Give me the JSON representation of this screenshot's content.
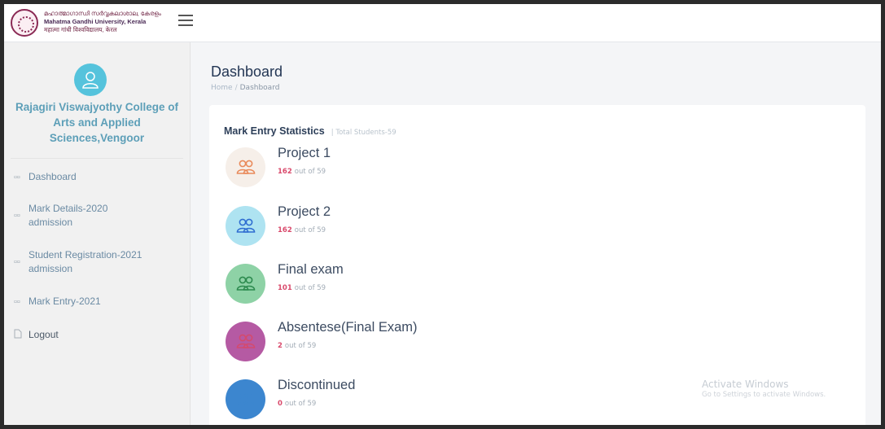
{
  "header": {
    "university_lines": [
      "മഹാത്മാഗാന്ധി സർവ്വകലാശാല, കേരളം",
      "Mahatma Gandhi University, Kerala",
      "महात्मा गांधी विश्वविद्यालय, केरल"
    ],
    "logo_icon": "university-seal-icon",
    "menu_icon": "hamburger-menu-icon"
  },
  "sidebar": {
    "avatar_icon": "user-avatar-icon",
    "avatar_color": "#55c3dc",
    "college_name": "Rajagiri Viswajyothy College of Arts and Applied Sciences,Vengoor",
    "items": [
      {
        "label": "Dashboard",
        "icon": "grid-icon"
      },
      {
        "label": "Mark Details-2020 admission",
        "icon": "grid-icon"
      },
      {
        "label": "Student Registration-2021 admission",
        "icon": "grid-icon"
      },
      {
        "label": "Mark Entry-2021",
        "icon": "grid-icon"
      },
      {
        "label": "Logout",
        "icon": "document-icon"
      }
    ]
  },
  "main": {
    "title": "Dashboard",
    "breadcrumb": [
      "Home",
      "Dashboard"
    ],
    "card": {
      "title": "Mark Entry Statistics",
      "subtitle": "| Total Students-59",
      "stats": [
        {
          "name": "Project 1",
          "count": "162",
          "suffix": "out of 59",
          "color": "#f6efe9",
          "icon_color": "#e98a5a",
          "icon": "users-icon"
        },
        {
          "name": "Project 2",
          "count": "162",
          "suffix": "out of 59",
          "color": "#aee3f1",
          "icon_color": "#2f6dd1",
          "icon": "users-icon"
        },
        {
          "name": "Final exam",
          "count": "101",
          "suffix": "out of 59",
          "color": "#8ed2a6",
          "icon_color": "#2c8a4e",
          "icon": "users-icon"
        },
        {
          "name": "Absentese(Final Exam)",
          "count": "2",
          "suffix": "out of 59",
          "color": "#b55aa3",
          "icon_color": "#d44a6e",
          "icon": "users-icon"
        },
        {
          "name": "Discontinued",
          "count": "0",
          "suffix": "out of 59",
          "color": "#3c86cf",
          "icon_color": "#3c86cf",
          "icon": "users-icon"
        }
      ]
    }
  },
  "watermark": {
    "line1": "Activate Windows",
    "line2": "Go to Settings to activate Windows."
  }
}
